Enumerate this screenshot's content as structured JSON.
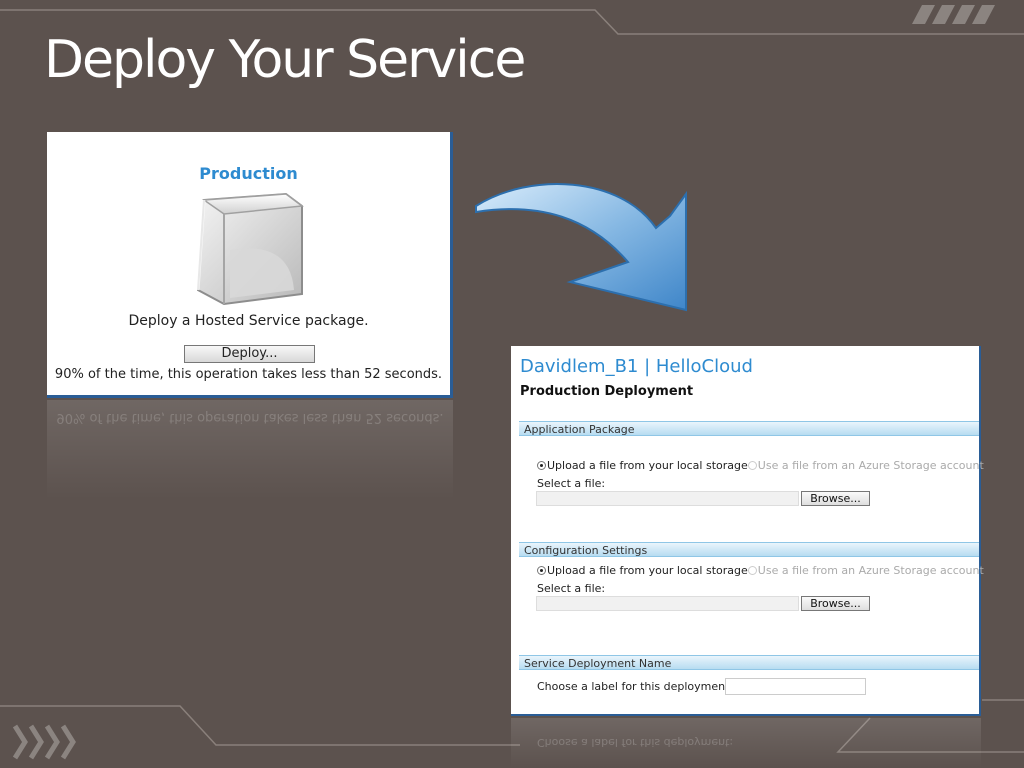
{
  "slide": {
    "title": "Deploy Your Service"
  },
  "production_panel": {
    "title": "Production",
    "description": "Deploy a Hosted Service package.",
    "deploy_button": "Deploy...",
    "note": "90% of the time, this operation takes less than 52 seconds."
  },
  "deployment_panel": {
    "breadcrumb": "Davidlem_B1 | HelloCloud",
    "heading": "Production Deployment",
    "sections": {
      "application_package": {
        "title": "Application Package",
        "option_local": "Upload a file from your local storage",
        "option_azure": "Use a file from an Azure Storage account",
        "select_label": "Select a file:",
        "browse_button": "Browse..."
      },
      "configuration_settings": {
        "title": "Configuration Settings",
        "option_local": "Upload a file from your local storage",
        "option_azure": "Use a file from an Azure Storage account",
        "select_label": "Select a file:",
        "browse_button": "Browse..."
      },
      "service_deployment_name": {
        "title": "Service Deployment Name",
        "label_prompt": "Choose a label for this deployment:",
        "label_value": ""
      }
    }
  },
  "colors": {
    "background": "#5c524e",
    "accent_blue": "#2e8bd0",
    "panel_border": "#2a5d96",
    "section_bar": "#b7dcf1"
  },
  "icons": {
    "cube": "glass-cube-icon",
    "arrow": "curved-arrow-icon",
    "chevrons": "chevron-right-icon"
  }
}
